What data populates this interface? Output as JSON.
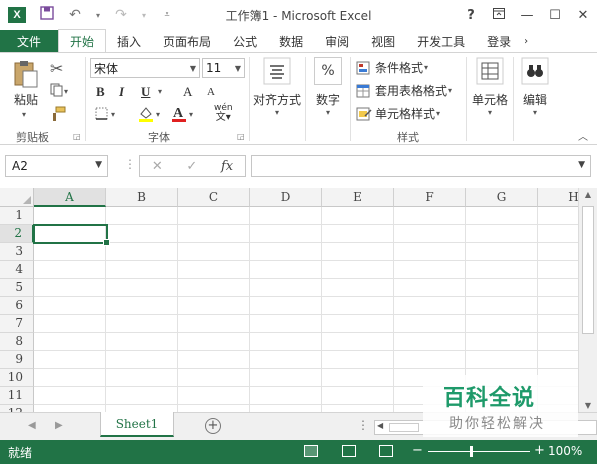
{
  "window": {
    "title": "工作簿1 - Microsoft Excel",
    "app_icon": "X",
    "help": "?",
    "controls": [
      "restore-ribbon",
      "minimize",
      "maximize",
      "close"
    ]
  },
  "tabs": [
    {
      "label": "文件"
    },
    {
      "label": "开始"
    },
    {
      "label": "插入"
    },
    {
      "label": "页面布局"
    },
    {
      "label": "公式"
    },
    {
      "label": "数据"
    },
    {
      "label": "审阅"
    },
    {
      "label": "视图"
    },
    {
      "label": "开发工具"
    },
    {
      "label": "登录"
    }
  ],
  "active_tab": "开始",
  "ribbon": {
    "clipboard": {
      "paste": "粘贴",
      "group": "剪贴板"
    },
    "font": {
      "name": "宋体",
      "size": "11",
      "bold": "B",
      "italic": "I",
      "underline": "U",
      "grow": "A",
      "shrink": "A",
      "phonetic": "wén",
      "group": "字体"
    },
    "alignment": {
      "label": "对齐方式"
    },
    "number": {
      "label": "数字",
      "symbol": "%"
    },
    "styles": {
      "conditional": "条件格式",
      "table": "套用表格格式",
      "cell_styles": "单元格样式",
      "group": "样式"
    },
    "cells": {
      "label": "单元格"
    },
    "editing": {
      "label": "编辑"
    }
  },
  "formula_bar": {
    "name_box": "A2",
    "fx": "fx",
    "value": ""
  },
  "grid": {
    "columns": [
      "A",
      "B",
      "C",
      "D",
      "E",
      "F",
      "G",
      "H"
    ],
    "rows": [
      "1",
      "2",
      "3",
      "4",
      "5",
      "6",
      "7",
      "8",
      "9",
      "10",
      "11",
      "12"
    ],
    "active_cell": "A2"
  },
  "sheets": [
    {
      "name": "Sheet1"
    }
  ],
  "status": {
    "text": "就绪",
    "zoom": "100%",
    "zoom_minus": "−",
    "zoom_plus": "+"
  },
  "watermark": {
    "main": "百科全说",
    "sub": "助你轻松解决"
  },
  "colors": {
    "accent": "#217346",
    "watermark": "#1e9a6a"
  }
}
